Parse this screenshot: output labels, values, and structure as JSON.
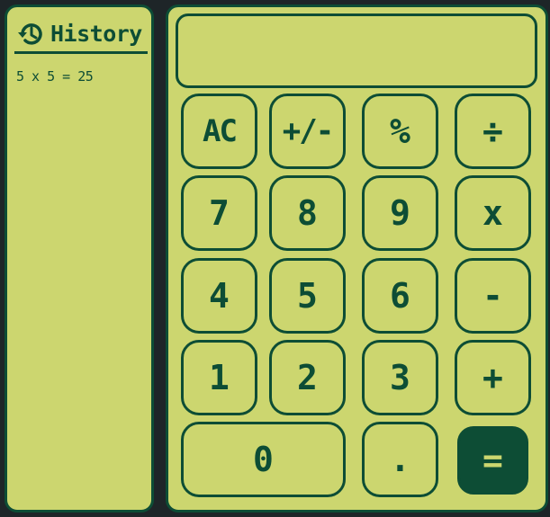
{
  "history": {
    "title": "History",
    "icon": "history-icon",
    "entries": [
      "5 x 5 = 25"
    ]
  },
  "display": {
    "value": ""
  },
  "keys": {
    "ac": "AC",
    "sign": "+/-",
    "percent": "%",
    "divide": "÷",
    "seven": "7",
    "eight": "8",
    "nine": "9",
    "multiply": "x",
    "four": "4",
    "five": "5",
    "six": "6",
    "minus": "-",
    "one": "1",
    "two": "2",
    "three": "3",
    "plus": "+",
    "zero": "0",
    "dot": ".",
    "equals": "="
  },
  "colors": {
    "panel": "#ccd66f",
    "accent": "#0d4d35",
    "background": "#1e2528"
  }
}
